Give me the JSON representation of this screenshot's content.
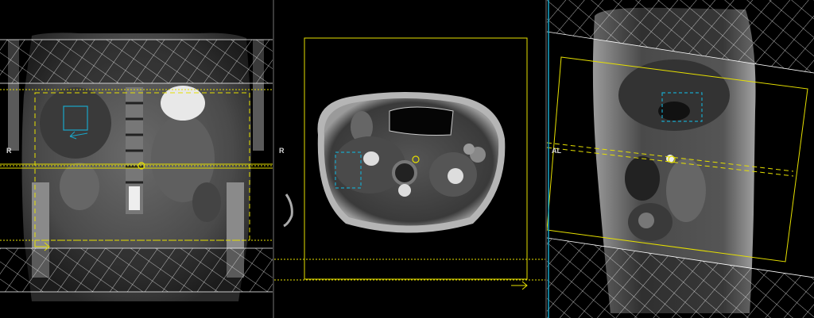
{
  "viewports": [
    {
      "id": "coronal",
      "orientation_label": "R"
    },
    {
      "id": "axial",
      "orientation_label": "R"
    },
    {
      "id": "sagittal",
      "orientation_label": "AL"
    }
  ],
  "colors": {
    "planning_box": "#e6e000",
    "roi_box": "#19a6c8",
    "saturation_band": "#ffffff",
    "background": "#000000"
  }
}
